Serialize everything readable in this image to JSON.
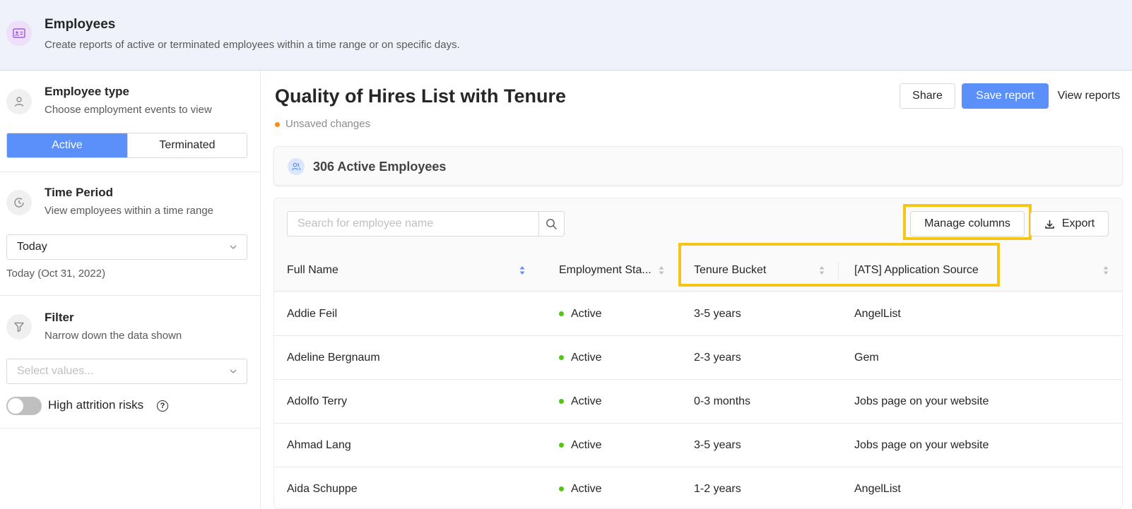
{
  "header": {
    "title": "Employees",
    "subtitle": "Create reports of active or terminated employees within a time range or on specific days."
  },
  "sidebar": {
    "employee_type": {
      "title": "Employee type",
      "subtitle": "Choose employment events to view",
      "options": [
        "Active",
        "Terminated"
      ],
      "selected": "Active"
    },
    "time_period": {
      "title": "Time Period",
      "subtitle": "View employees within a time range",
      "selected": "Today",
      "date_text": "Today (Oct 31, 2022)"
    },
    "filter": {
      "title": "Filter",
      "subtitle": "Narrow down the data shown",
      "placeholder": "Select values...",
      "toggle_label": "High attrition risks",
      "toggle_on": false
    }
  },
  "main": {
    "title": "Quality of Hires List with Tenure",
    "unsaved": "Unsaved changes",
    "actions": {
      "share": "Share",
      "save": "Save report",
      "view": "View reports"
    },
    "count_text": "306 Active Employees",
    "toolbar": {
      "search_placeholder": "Search for employee name",
      "manage_columns": "Manage columns",
      "export": "Export"
    },
    "table": {
      "columns": [
        "Full Name",
        "Employment Sta...",
        "Tenure Bucket",
        "[ATS] Application Source"
      ],
      "rows": [
        {
          "name": "Addie Feil",
          "status": "Active",
          "tenure": "3-5 years",
          "source": "AngelList"
        },
        {
          "name": "Adeline Bergnaum",
          "status": "Active",
          "tenure": "2-3 years",
          "source": "Gem"
        },
        {
          "name": "Adolfo Terry",
          "status": "Active",
          "tenure": "0-3 months",
          "source": "Jobs page on your website"
        },
        {
          "name": "Ahmad Lang",
          "status": "Active",
          "tenure": "3-5 years",
          "source": "Jobs page on your website"
        },
        {
          "name": "Aida Schuppe",
          "status": "Active",
          "tenure": "1-2 years",
          "source": "AngelList"
        }
      ]
    }
  },
  "colors": {
    "primary": "#5b8ff9",
    "highlight": "#f5c518",
    "active_status": "#52c41a",
    "unsaved_dot": "#fa8c16",
    "header_bg": "#eff2fa"
  },
  "icons": [
    "id-card-icon",
    "user-icon",
    "clock-icon",
    "filter-icon",
    "chevron-down-icon",
    "help-icon",
    "users-icon",
    "search-icon",
    "download-icon",
    "sort-icon"
  ]
}
